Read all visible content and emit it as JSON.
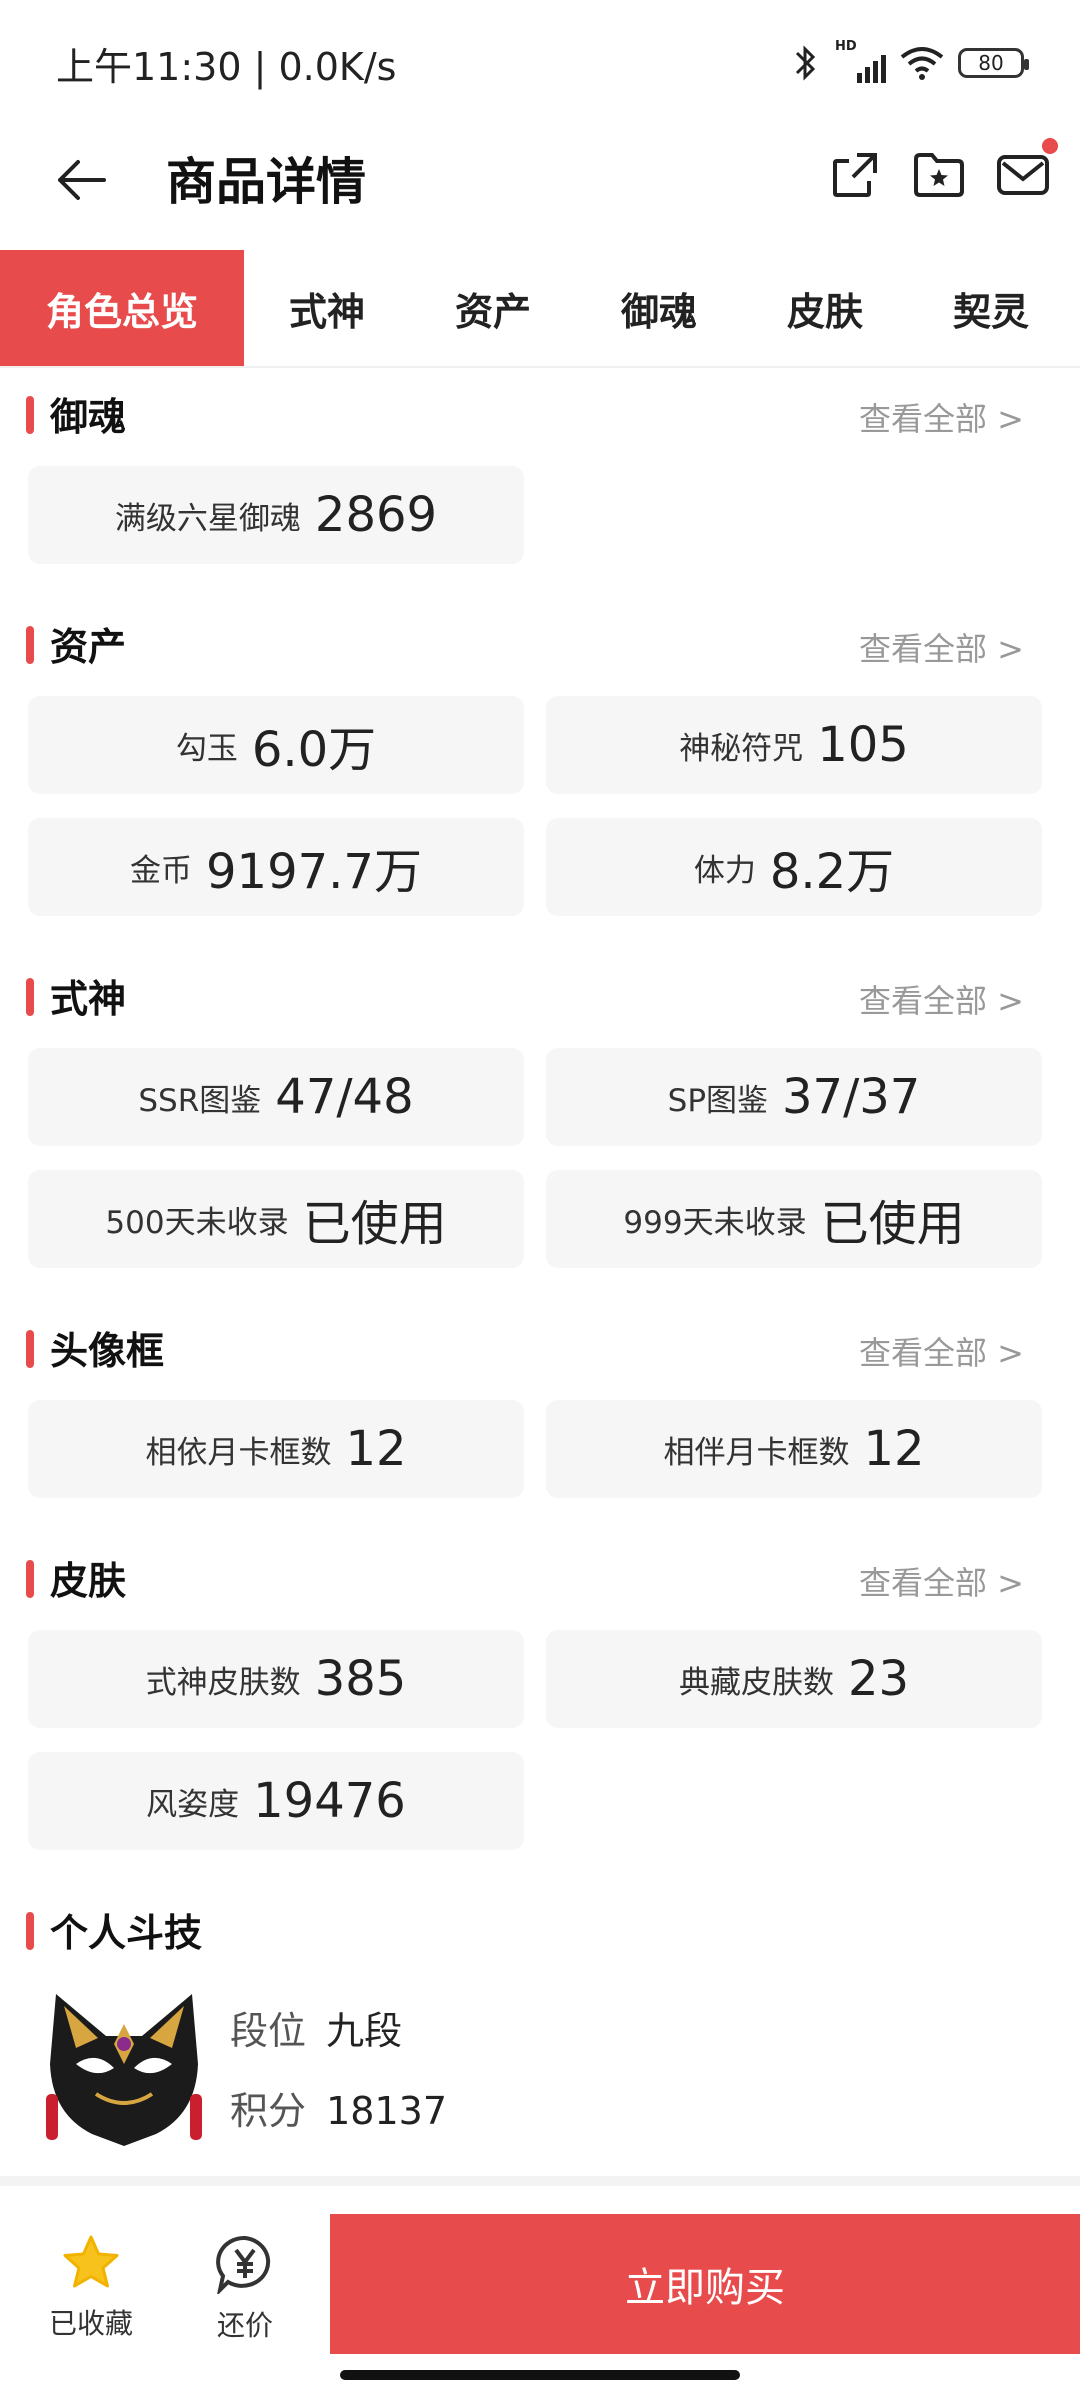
{
  "status_bar": {
    "time_speed": "上午11:30 | 0.0K/s",
    "network_label": "HD",
    "battery": "80"
  },
  "header": {
    "title": "商品详情"
  },
  "tabs": [
    {
      "label": "角色总览",
      "active": true
    },
    {
      "label": "式神"
    },
    {
      "label": "资产"
    },
    {
      "label": "御魂"
    },
    {
      "label": "皮肤"
    },
    {
      "label": "契灵"
    }
  ],
  "view_all_label": "查看全部 >",
  "sections": {
    "yuhun": {
      "title": "御魂",
      "items": [
        {
          "label": "满级六星御魂",
          "value": "2869"
        }
      ]
    },
    "assets": {
      "title": "资产",
      "items": [
        {
          "label": "勾玉",
          "value": "6.0万"
        },
        {
          "label": "神秘符咒",
          "value": "105"
        },
        {
          "label": "金币",
          "value": "9197.7万"
        },
        {
          "label": "体力",
          "value": "8.2万"
        }
      ]
    },
    "shikigami": {
      "title": "式神",
      "items": [
        {
          "label": "SSR图鉴",
          "value": "47/48"
        },
        {
          "label": "SP图鉴",
          "value": "37/37"
        },
        {
          "label": "500天未收录",
          "value": "已使用"
        },
        {
          "label": "999天未收录",
          "value": "已使用"
        }
      ]
    },
    "frame": {
      "title": "头像框",
      "items": [
        {
          "label": "相依月卡框数",
          "value": "12"
        },
        {
          "label": "相伴月卡框数",
          "value": "12"
        }
      ]
    },
    "skin": {
      "title": "皮肤",
      "items": [
        {
          "label": "式神皮肤数",
          "value": "385"
        },
        {
          "label": "典藏皮肤数",
          "value": "23"
        },
        {
          "label": "风姿度",
          "value": "19476"
        }
      ]
    },
    "pk": {
      "title": "个人斗技",
      "rank_label": "段位",
      "rank_value": "九段",
      "score_label": "积分",
      "score_value": "18137"
    }
  },
  "bottom_bar": {
    "favorite_label": "已收藏",
    "bargain_label": "还价",
    "buy_label": "立即购买"
  },
  "colors": {
    "accent": "#e84b4b",
    "card_bg": "#f6f6f6",
    "star": "#f7c21b"
  },
  "icons": [
    "back-arrow-icon",
    "share-icon",
    "folder-star-icon",
    "mail-icon",
    "star-icon",
    "yen-bubble-icon",
    "fox-mask-icon"
  ]
}
